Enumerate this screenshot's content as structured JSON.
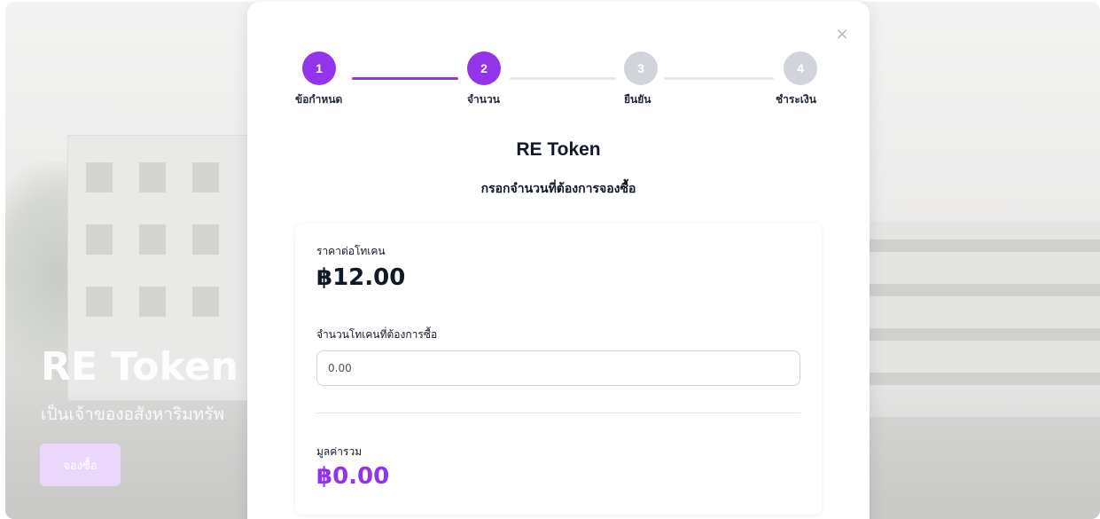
{
  "hero": {
    "title": "RE Token",
    "subtitle": "เป็นเจ้าของอสังหาริมทรัพ",
    "button_label": "จองซื้อ"
  },
  "modal": {
    "close_icon": "close-icon",
    "close_glyph": "×",
    "title": "RE Token",
    "subtitle": "กรอกจำนวนที่ต้องการจองซื้อ",
    "steps": [
      {
        "number": "1",
        "label": "ข้อกำหนด",
        "state": "active"
      },
      {
        "number": "2",
        "label": "จำนวน",
        "state": "active"
      },
      {
        "number": "3",
        "label": "ยืนยัน",
        "state": "inactive"
      },
      {
        "number": "4",
        "label": "ชำระเงิน",
        "state": "inactive"
      }
    ],
    "card": {
      "price_label": "ราคาต่อโทเคน",
      "price_value": "฿12.00",
      "amount_label": "จำนวนโทเคนที่ต้องการซื้อ",
      "amount_placeholder": "0.00",
      "total_label": "มูลค่ารวม",
      "total_value": "฿0.00"
    }
  },
  "colors": {
    "accent": "#9333ea",
    "inactive_step": "#d1d5db",
    "hero_button_bg": "#ead7fb"
  }
}
